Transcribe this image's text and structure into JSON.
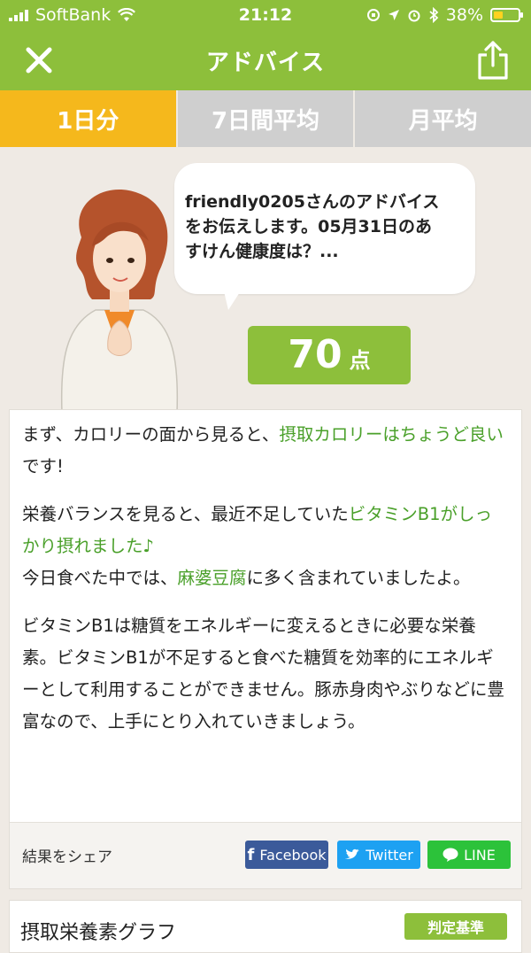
{
  "status_bar": {
    "carrier": "SoftBank",
    "time": "21:12",
    "battery": "38%",
    "battery_level": 0.38
  },
  "navbar": {
    "title": "アドバイス"
  },
  "tabs": [
    {
      "label": "1日分",
      "active": true
    },
    {
      "label": "7日間平均",
      "active": false
    },
    {
      "label": "月平均",
      "active": false
    }
  ],
  "advisor": {
    "speech_line1": "friendly0205さんのアドバイス",
    "speech_line2": "をお伝えします。05月31日のあ",
    "speech_line3": "すけん健康度は？..."
  },
  "score": {
    "value": "70",
    "unit": "点"
  },
  "advice": {
    "p1_a": "まず、カロリーの面から見ると、",
    "p1_hl": "摂取カロリーはちょうど良い",
    "p1_b": "です!",
    "p2_a": "栄養バランスを見ると、最近不足していた",
    "p2_hl": "ビタミンB1がしっかり摂れました♪",
    "p2_c": "今日食べた中では、",
    "p2_hl2": "麻婆豆腐",
    "p2_d": "に多く含まれていましたよ。",
    "p3": "ビタミンB1は糖質をエネルギーに変えるときに必要な栄養素。ビタミンB1が不足すると食べた糖質を効率的にエネルギーとして利用することができません。豚赤身肉やぶりなどに豊富なので、上手にとり入れていきましょう。"
  },
  "share": {
    "label": "結果をシェア",
    "facebook": "Facebook",
    "twitter": "Twitter",
    "line": "LINE"
  },
  "graph_section": {
    "title": "摂取栄養素グラフ",
    "criteria_button": "判定基準"
  },
  "colors": {
    "brand_green": "#8dbf3b",
    "active_tab": "#f5b81c",
    "highlight_text": "#4aa02a"
  }
}
